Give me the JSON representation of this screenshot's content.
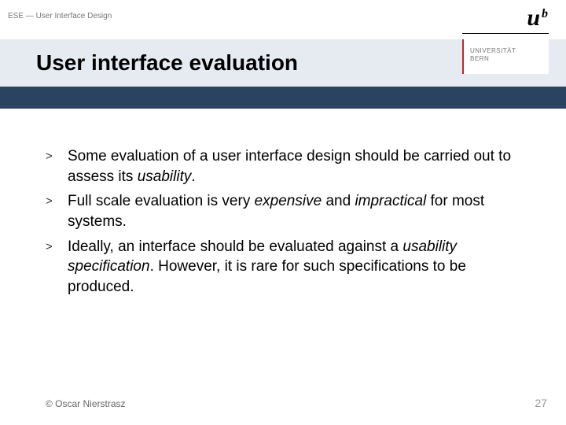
{
  "header": {
    "course_label": "ESE — User Interface Design",
    "logo_u": "u",
    "logo_sup": "b",
    "uni_line1": "UNIVERSITÄT",
    "uni_line2": "BERN"
  },
  "title": "User interface evaluation",
  "bullets": [
    {
      "parts": [
        {
          "t": "Some evaluation of a user interface design should be carried out to assess its ",
          "em": false
        },
        {
          "t": "usability",
          "em": true
        },
        {
          "t": ".",
          "em": false
        }
      ]
    },
    {
      "parts": [
        {
          "t": "Full scale evaluation is very ",
          "em": false
        },
        {
          "t": "expensive",
          "em": true
        },
        {
          "t": " and ",
          "em": false
        },
        {
          "t": "impractical",
          "em": true
        },
        {
          "t": " for most systems.",
          "em": false
        }
      ]
    },
    {
      "parts": [
        {
          "t": "Ideally, an interface should be evaluated against a ",
          "em": false
        },
        {
          "t": "usability specification",
          "em": true
        },
        {
          "t": ". However, it is rare for such specifications to be produced.",
          "em": false
        }
      ]
    }
  ],
  "footer": {
    "copyright": "© Oscar Nierstrasz",
    "page": "27"
  },
  "marker": ">"
}
